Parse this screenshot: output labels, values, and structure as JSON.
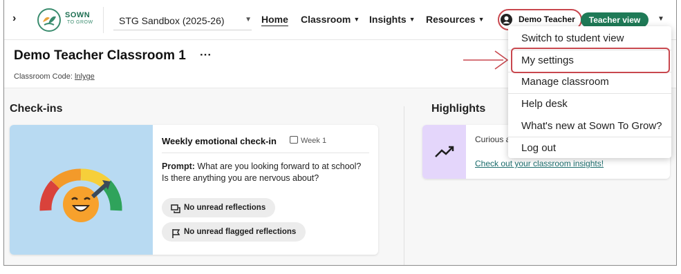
{
  "topnav": {
    "logo_line1": "SOWN",
    "logo_line2": "TO GROW",
    "sandbox_value": "STG Sandbox (2025-26)",
    "links": [
      {
        "label": "Home",
        "active": true,
        "dropdown": false
      },
      {
        "label": "Classroom",
        "active": false,
        "dropdown": true
      },
      {
        "label": "Insights",
        "active": false,
        "dropdown": true
      },
      {
        "label": "Resources",
        "active": false,
        "dropdown": true
      }
    ],
    "user_name": "Demo Teacher",
    "view_badge": "Teacher view"
  },
  "classroom": {
    "title": "Demo Teacher Classroom 1",
    "more": "···",
    "code_label": "Classroom Code:",
    "code_value": "lnlyge"
  },
  "checkins": {
    "section_title": "Check-ins",
    "card_title": "Weekly emotional check-in",
    "week": "Week 1",
    "prompt_label": "Prompt:",
    "prompt_text": "What are you looking forward to at school? Is there anything you are nervous about?",
    "pill_reflections": "No unread reflections",
    "pill_flagged": "No unread flagged reflections"
  },
  "highlights": {
    "section_title": "Highlights",
    "text": "Curious about your students' well-being?",
    "link": "Check out your classroom insights!"
  },
  "dropdown": {
    "items": [
      "Switch to student view",
      "My settings",
      "Manage classroom",
      "Help desk",
      "What's new at Sown To Grow?",
      "Log out"
    ]
  },
  "colors": {
    "brand_green": "#1f7a57",
    "annotation_red": "#c8474e",
    "checkin_bg": "#b8daf2",
    "highlight_icon_bg": "#e4d6fb"
  }
}
